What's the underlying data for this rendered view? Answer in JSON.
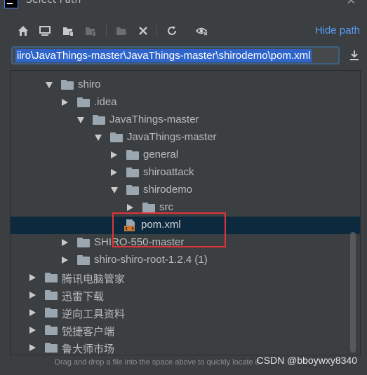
{
  "window": {
    "title": "Select Path",
    "close_glyph": "✕"
  },
  "toolbar": {
    "buttons": [
      {
        "name": "home-icon"
      },
      {
        "name": "desktop-icon"
      },
      {
        "name": "project-folder-icon"
      },
      {
        "name": "module-folder-icon"
      },
      {
        "name": "new-folder-icon"
      },
      {
        "name": "delete-icon"
      },
      {
        "name": "refresh-icon"
      },
      {
        "name": "show-hidden-icon"
      }
    ],
    "hide_path_label": "Hide path"
  },
  "path_input": {
    "value": "iiro\\JavaThings-master\\JavaThings-master\\shirodemo\\pom.xml"
  },
  "tree": {
    "rows": [
      {
        "label": "shiro",
        "state": "expanded"
      },
      {
        "label": ".idea",
        "state": "collapsed"
      },
      {
        "label": "JavaThings-master",
        "state": "expanded"
      },
      {
        "label": "JavaThings-master",
        "state": "expanded"
      },
      {
        "label": "general",
        "state": "collapsed"
      },
      {
        "label": "shiroattack",
        "state": "collapsed"
      },
      {
        "label": "shirodemo",
        "state": "expanded"
      },
      {
        "label": "src",
        "state": "collapsed"
      },
      {
        "label": "pom.xml",
        "state": "file",
        "selected": true
      },
      {
        "label": "SHIRO-550-master",
        "state": "collapsed"
      },
      {
        "label": "shiro-shiro-root-1.2.4 (1)",
        "state": "collapsed"
      },
      {
        "label": "腾讯电脑管家",
        "state": "collapsed"
      },
      {
        "label": "迅雷下载",
        "state": "collapsed"
      },
      {
        "label": "逆向工具资料",
        "state": "collapsed"
      },
      {
        "label": "锐捷客户端",
        "state": "collapsed"
      },
      {
        "label": "鲁大师市场",
        "state": "collapsed"
      }
    ]
  },
  "footer": {
    "hint": "Drag and drop a file into the space above to quickly locate it",
    "watermark": "CSDN @bboywxy8340"
  },
  "colors": {
    "accent": "#589df6",
    "selection": "#2f65ca",
    "selected_row": "#0d293e",
    "highlight_box": "#e0343a"
  }
}
